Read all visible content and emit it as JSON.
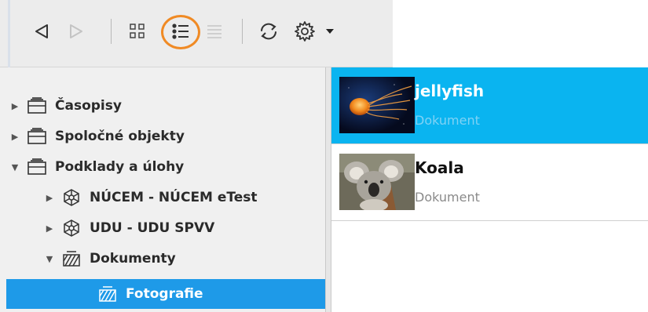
{
  "toolbar": {
    "buttons": [
      {
        "name": "back",
        "icon": "triangle-left-icon",
        "enabled": true
      },
      {
        "name": "forward",
        "icon": "triangle-right-icon",
        "enabled": false
      },
      {
        "name": "grid-view",
        "icon": "grid-icon",
        "enabled": true
      },
      {
        "name": "list-view",
        "icon": "list-icon",
        "enabled": true,
        "highlighted": true
      },
      {
        "name": "detail-view",
        "icon": "lines-icon",
        "enabled": false
      },
      {
        "name": "refresh",
        "icon": "refresh-icon",
        "enabled": true
      },
      {
        "name": "settings",
        "icon": "gear-icon",
        "enabled": true
      },
      {
        "name": "settings-dropdown",
        "icon": "caret-down-icon",
        "enabled": true
      }
    ],
    "highlight_color": "#f08a24"
  },
  "tree": {
    "items": [
      {
        "label": "Časopisy",
        "expanded": false,
        "level": 0,
        "icon": "tray-icon"
      },
      {
        "label": "Spoločné objekty",
        "expanded": false,
        "level": 0,
        "icon": "tray-icon"
      },
      {
        "label": "Podklady a úlohy",
        "expanded": true,
        "level": 0,
        "icon": "tray-icon"
      },
      {
        "label": "NÚCEM - NÚCEM eTest",
        "expanded": false,
        "level": 1,
        "icon": "network-cube-icon"
      },
      {
        "label": "UDU - UDU SPVV",
        "expanded": false,
        "level": 1,
        "icon": "network-cube-icon"
      },
      {
        "label": "Dokumenty",
        "expanded": true,
        "level": 1,
        "icon": "hatched-tray-icon"
      },
      {
        "label": "Fotografie",
        "expanded": false,
        "level": 2,
        "icon": "hatched-tray-icon",
        "selected": true
      }
    ],
    "selection_color": "#1e9ae8"
  },
  "list": {
    "items": [
      {
        "title": "jellyfish",
        "subtitle": "Dokument",
        "thumbnail": "jellyfish-photo",
        "selected": true
      },
      {
        "title": "Koala",
        "subtitle": "Dokument",
        "thumbnail": "koala-photo",
        "selected": false
      }
    ],
    "selection_color": "#0ab4f0"
  }
}
